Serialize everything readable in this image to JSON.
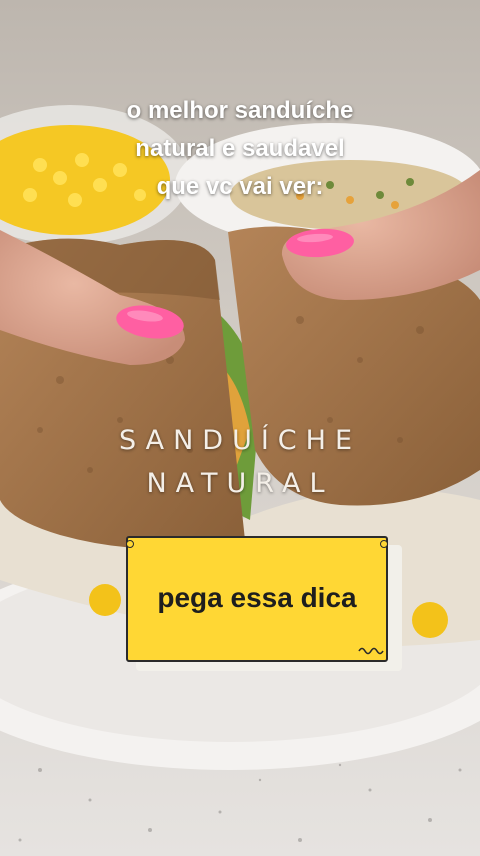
{
  "caption": {
    "line1": "o melhor sanduíche",
    "line2": "natural e saudavel",
    "line3": "que vc vai ver:"
  },
  "title": {
    "line1": "SANDUÍCHE",
    "line2": "NATURAL"
  },
  "sticker": {
    "text": "pega essa dica",
    "color": "#ffd734"
  },
  "colors": {
    "bread": "#9a6f45",
    "plate": "#f2f0ee",
    "nail_polish": "#ff5fa2",
    "corn": "#f3c21a"
  }
}
